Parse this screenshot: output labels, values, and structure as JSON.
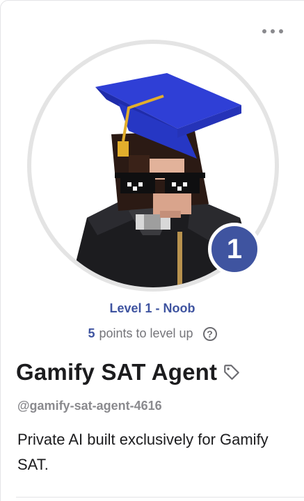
{
  "profile": {
    "level_text": "Level 1 - Noob",
    "level_number": "1",
    "points_number": "5",
    "points_text": "points to level up",
    "name": "Gamify SAT Agent",
    "handle": "@gamify-sat-agent-4616",
    "bio": "Private AI built exclusively for Gamify SAT."
  },
  "icons": {
    "more": "more-options-icon",
    "help": "help-icon",
    "tag": "tag-icon"
  },
  "colors": {
    "accent": "#3f54a0",
    "cap": "#2f3fd6",
    "tassel": "#e2ae2c"
  }
}
